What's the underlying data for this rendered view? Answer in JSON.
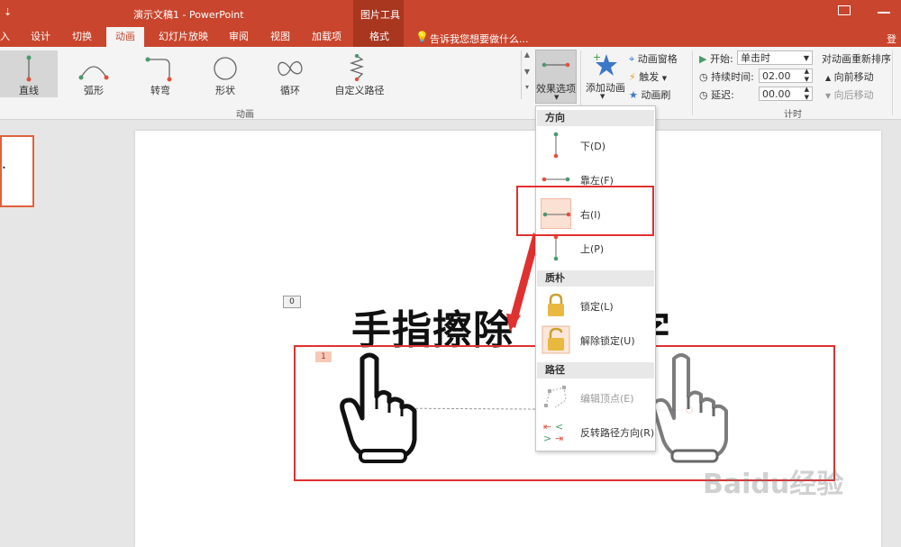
{
  "titlebar": {
    "qat_arrow": "⇣",
    "doc_title": "演示文稿1 - PowerPoint",
    "context_tools": "图片工具"
  },
  "tabs": {
    "items": [
      "入",
      "设计",
      "切换",
      "动画",
      "幻灯片放映",
      "审阅",
      "视图",
      "加载项",
      "格式"
    ],
    "active": "动画",
    "tell_me": "告诉我您想要做什么...",
    "signin": "登录"
  },
  "ribbon": {
    "animation_gallery": [
      "直线",
      "弧形",
      "转弯",
      "形状",
      "循环",
      "自定义路径"
    ],
    "animation_group_label": "动画",
    "effect_options": "效果选项",
    "add_animation": "添加动画",
    "advanced": [
      "动画窗格",
      "触发",
      "动画刷"
    ],
    "timing": {
      "start_label": "开始:",
      "start_value": "单击时",
      "duration_label": "持续时间:",
      "duration_value": "02.00",
      "delay_label": "延迟:",
      "delay_value": "00.00",
      "group_label": "计时"
    },
    "reorder": {
      "title": "对动画重新排序",
      "forward": "向前移动",
      "backward": "向后移动"
    }
  },
  "slide": {
    "headline_left": "手指擦除",
    "headline_right": "字",
    "tag0": "0",
    "tag1": "1",
    "watermark": "Baidu经验"
  },
  "dropdown": {
    "direction_header": "方向",
    "directions": [
      "下(D)",
      "靠左(F)",
      "右(I)",
      "上(P)"
    ],
    "selected": "右(I)",
    "origin_header": "质朴",
    "origin_items": [
      "锁定(L)",
      "解除锁定(U)"
    ],
    "path_header": "路径",
    "path_items": [
      "编辑顶点(E)",
      "反转路径方向(R)"
    ]
  },
  "colors": {
    "accent": "#c9452d",
    "highlight_border": "#e03030",
    "motion_start": "#4caf50",
    "motion_end": "#e05040"
  }
}
